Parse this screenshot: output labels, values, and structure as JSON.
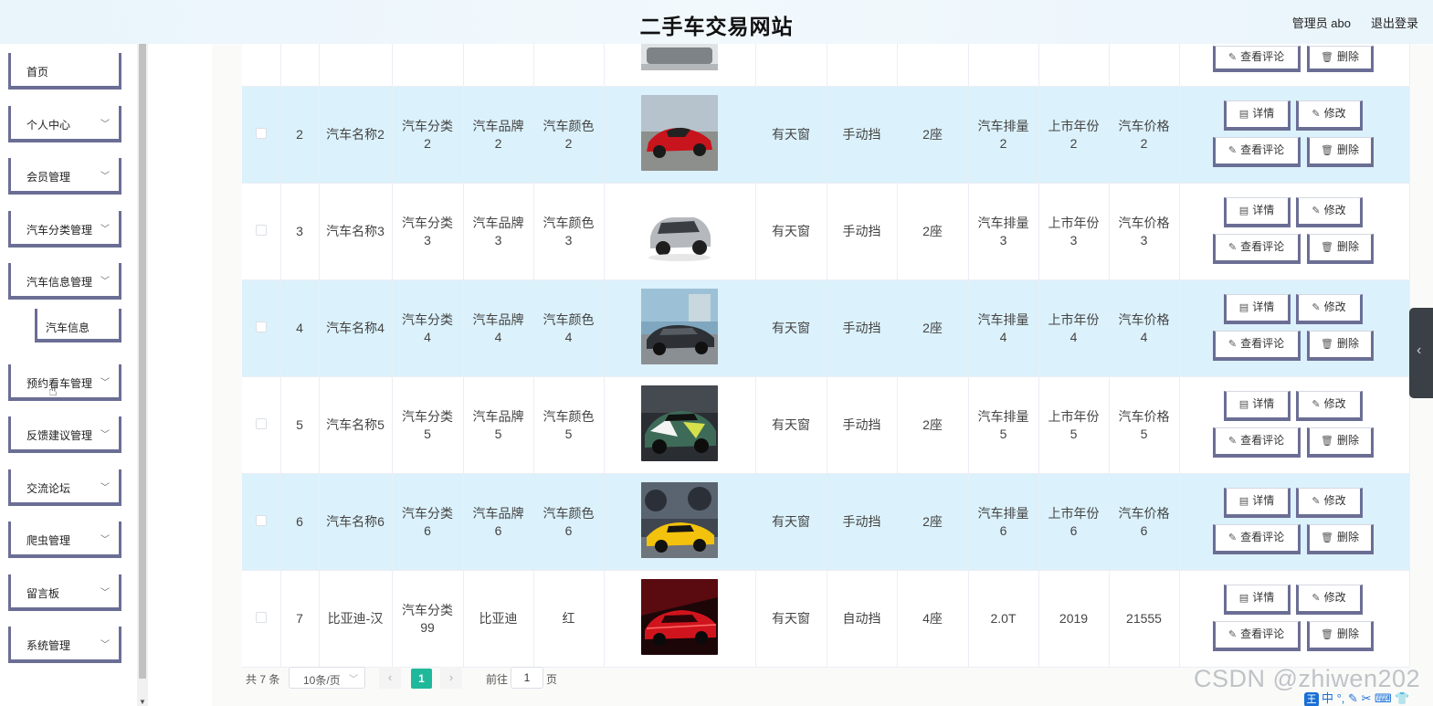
{
  "header": {
    "title": "二手车交易网站",
    "admin": "管理员 abo",
    "logout": "退出登录"
  },
  "sidebar": {
    "items": [
      {
        "label": "首页",
        "expandable": false
      },
      {
        "label": "个人中心",
        "expandable": true
      },
      {
        "label": "会员管理",
        "expandable": true
      },
      {
        "label": "汽车分类管理",
        "expandable": true
      },
      {
        "label": "汽车信息管理",
        "expandable": true
      },
      {
        "label": "汽车信息",
        "expandable": false,
        "submenu": true
      },
      {
        "label": "预约看车管理",
        "expandable": true
      },
      {
        "label": "反馈建议管理",
        "expandable": true
      },
      {
        "label": "交流论坛",
        "expandable": true
      },
      {
        "label": "爬虫管理",
        "expandable": true
      },
      {
        "label": "留言板",
        "expandable": true
      },
      {
        "label": "系统管理",
        "expandable": true
      }
    ]
  },
  "table": {
    "buttons": {
      "detail": "详情",
      "edit": "修改",
      "comments": "查看评论",
      "delete": "删除"
    },
    "rows": [
      {
        "index": "2",
        "name": "汽车名称2",
        "category": "汽车分类\n2",
        "brand": "汽车品牌\n2",
        "color": "汽车颜色\n2",
        "image": "red-sports-car",
        "sunroof": "有天窗",
        "gearbox": "手动挡",
        "seats": "2座",
        "displacement": "汽车排量\n2",
        "year": "上市年份\n2",
        "price": "汽车价格\n2"
      },
      {
        "index": "3",
        "name": "汽车名称3",
        "category": "汽车分类\n3",
        "brand": "汽车品牌\n3",
        "color": "汽车颜色\n3",
        "image": "silver-suv",
        "sunroof": "有天窗",
        "gearbox": "手动挡",
        "seats": "2座",
        "displacement": "汽车排量\n3",
        "year": "上市年份\n3",
        "price": "汽车价格\n3"
      },
      {
        "index": "4",
        "name": "汽车名称4",
        "category": "汽车分类\n4",
        "brand": "汽车品牌\n4",
        "color": "汽车颜色\n4",
        "image": "dark-sedan",
        "sunroof": "有天窗",
        "gearbox": "手动挡",
        "seats": "2座",
        "displacement": "汽车排量\n4",
        "year": "上市年份\n4",
        "price": "汽车价格\n4"
      },
      {
        "index": "5",
        "name": "汽车名称5",
        "category": "汽车分类\n5",
        "brand": "汽车品牌\n5",
        "color": "汽车颜色\n5",
        "image": "wrapped-race-car",
        "sunroof": "有天窗",
        "gearbox": "手动挡",
        "seats": "2座",
        "displacement": "汽车排量\n5",
        "year": "上市年份\n5",
        "price": "汽车价格\n5"
      },
      {
        "index": "6",
        "name": "汽车名称6",
        "category": "汽车分类\n6",
        "brand": "汽车品牌\n6",
        "color": "汽车颜色\n6",
        "image": "yellow-supercar",
        "sunroof": "有天窗",
        "gearbox": "手动挡",
        "seats": "2座",
        "displacement": "汽车排量\n6",
        "year": "上市年份\n6",
        "price": "汽车价格\n6"
      },
      {
        "index": "7",
        "name": "比亚迪-汉",
        "category": "汽车分类\n99",
        "brand": "比亚迪",
        "color": "红",
        "image": "red-sedan",
        "sunroof": "有天窗",
        "gearbox": "自动挡",
        "seats": "4座",
        "displacement": "2.0T",
        "year": "2019",
        "price": "21555"
      }
    ]
  },
  "pagination": {
    "total": "共 7 条",
    "page_size": "10条/页",
    "current_page": "1",
    "goto_prefix": "前往",
    "goto_value": "1",
    "goto_suffix": "页"
  },
  "watermark": "CSDN @zhiwen202",
  "colors": {
    "accent": "#1fb89a",
    "row_highlight": "#dbf1fb",
    "button_border": "#6b6e94"
  }
}
